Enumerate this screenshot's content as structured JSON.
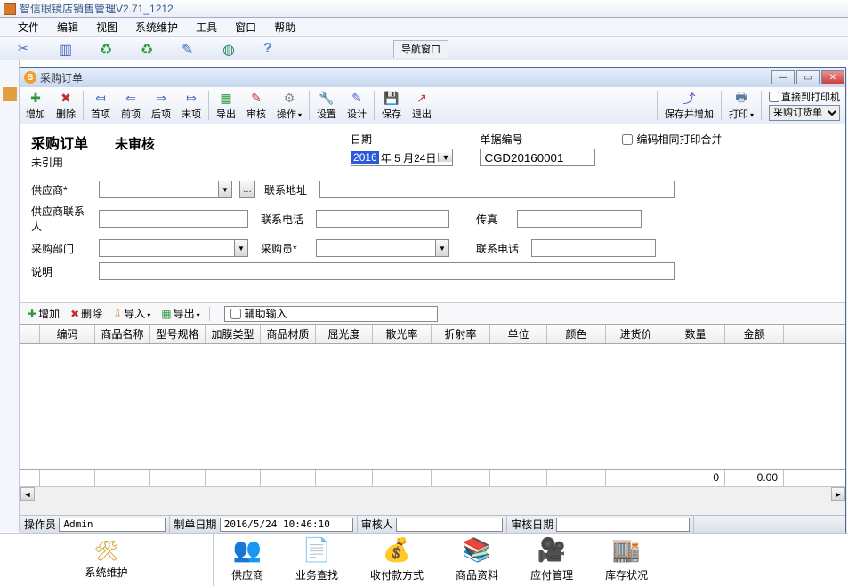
{
  "app": {
    "title": "智信眼镜店销售管理V2.71_1212"
  },
  "menu": {
    "items": [
      "文件",
      "编辑",
      "视图",
      "系统维护",
      "工具",
      "窗口",
      "帮助"
    ]
  },
  "main_tab_stub": "导航窗口",
  "child": {
    "title": "采购订单",
    "toolbar": {
      "add": "增加",
      "del": "删除",
      "first": "首项",
      "prev": "前项",
      "next": "后项",
      "last": "末项",
      "export": "导出",
      "audit": "审核",
      "op": "操作",
      "setting": "设置",
      "design": "设计",
      "save": "保存",
      "exit": "退出",
      "saveadd": "保存并增加",
      "print": "打印",
      "direct_printer": "直接到打印机",
      "print_doc_type": "采购订货单"
    },
    "form": {
      "title": "采购订单",
      "status": "未审核",
      "sub": "未引用",
      "date_label": "日期",
      "date_year": "2016",
      "date_rest": "年 5 月24日",
      "docno_label": "单据编号",
      "docno": "CGD20160001",
      "merge_label": "编码相同打印合并",
      "supplier_label": "供应商*",
      "contact_addr_label": "联系地址",
      "supplier_contact_label": "供应商联系人",
      "phone_label": "联系电话",
      "fax_label": "传真",
      "dept_label": "采购部门",
      "buyer_label": "采购员*",
      "phone2_label": "联系电话",
      "desc_label": "说明"
    },
    "grid_toolbar": {
      "add": "增加",
      "del": "删除",
      "import": "导入",
      "export": "导出",
      "aux_input": "辅助输入"
    },
    "grid": {
      "columns": [
        "",
        "编码",
        "商品名称",
        "型号规格",
        "加膜类型",
        "商品材质",
        "屈光度",
        "散光率",
        "折射率",
        "单位",
        "颜色",
        "进货价",
        "数量",
        "金额"
      ],
      "widths": [
        22,
        62,
        62,
        62,
        62,
        62,
        64,
        66,
        66,
        64,
        66,
        68,
        66,
        66
      ],
      "sum_qty": "0",
      "sum_amt": "0.00"
    },
    "footer": {
      "operator_label": "操作员",
      "operator": "Admin",
      "create_label": "制单日期",
      "create": "2016/5/24 10:46:10",
      "auditor_label": "审核人",
      "audit_date_label": "审核日期"
    }
  },
  "bottom_nav": {
    "left": "系统维护",
    "items": [
      "供应商",
      "业务查找",
      "收付款方式",
      "商品资料",
      "应付管理",
      "库存状况"
    ]
  }
}
